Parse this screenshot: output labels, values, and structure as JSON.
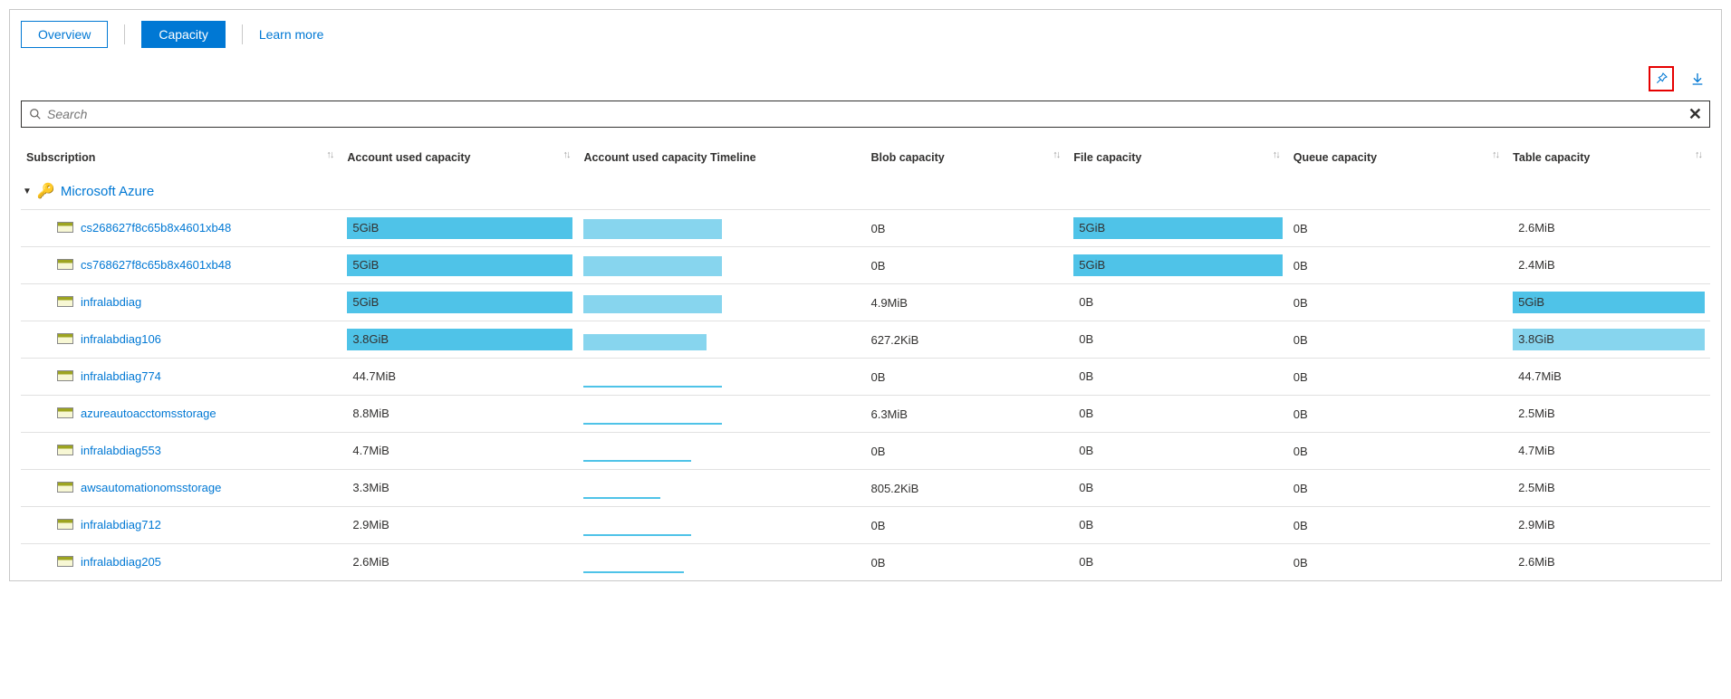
{
  "tabs": {
    "overview": "Overview",
    "capacity": "Capacity"
  },
  "learn_more": "Learn more",
  "search": {
    "placeholder": "Search"
  },
  "columns": {
    "c0": "Subscription",
    "c1": "Account used capacity",
    "c2": "Account used capacity Timeline",
    "c3": "Blob capacity",
    "c4": "File capacity",
    "c5": "Queue capacity",
    "c6": "Table capacity"
  },
  "group": "Microsoft Azure",
  "rows": [
    {
      "name": "cs268627f8c65b8x4601xb48",
      "used": "5GiB",
      "used_pct": 100,
      "tl_h": 22,
      "tl_w": 90,
      "blob": "0B",
      "file": "5GiB",
      "file_pct": 100,
      "queue": "0B",
      "table": "2.6MiB",
      "table_pct": 0
    },
    {
      "name": "cs768627f8c65b8x4601xb48",
      "used": "5GiB",
      "used_pct": 100,
      "tl_h": 22,
      "tl_w": 90,
      "blob": "0B",
      "file": "5GiB",
      "file_pct": 100,
      "queue": "0B",
      "table": "2.4MiB",
      "table_pct": 0
    },
    {
      "name": "infralabdiag",
      "used": "5GiB",
      "used_pct": 100,
      "tl_h": 20,
      "tl_w": 90,
      "blob": "4.9MiB",
      "file": "0B",
      "file_pct": 0,
      "queue": "0B",
      "table": "5GiB",
      "table_pct": 100
    },
    {
      "name": "infralabdiag106",
      "used": "3.8GiB",
      "used_pct": 100,
      "tl_h": 18,
      "tl_w": 80,
      "blob": "627.2KiB",
      "file": "0B",
      "file_pct": 0,
      "queue": "0B",
      "table": "3.8GiB",
      "table_pct": 100,
      "light": true
    },
    {
      "name": "infralabdiag774",
      "used": "44.7MiB",
      "used_pct": 0,
      "tl_h": 2,
      "tl_w": 90,
      "blob": "0B",
      "file": "0B",
      "file_pct": 0,
      "queue": "0B",
      "table": "44.7MiB",
      "table_pct": 0
    },
    {
      "name": "azureautoacctomsstorage",
      "used": "8.8MiB",
      "used_pct": 0,
      "tl_h": 2,
      "tl_w": 90,
      "blob": "6.3MiB",
      "file": "0B",
      "file_pct": 0,
      "queue": "0B",
      "table": "2.5MiB",
      "table_pct": 0
    },
    {
      "name": "infralabdiag553",
      "used": "4.7MiB",
      "used_pct": 0,
      "tl_h": 2,
      "tl_w": 70,
      "blob": "0B",
      "file": "0B",
      "file_pct": 0,
      "queue": "0B",
      "table": "4.7MiB",
      "table_pct": 0
    },
    {
      "name": "awsautomationomsstorage",
      "used": "3.3MiB",
      "used_pct": 0,
      "tl_h": 2,
      "tl_w": 50,
      "blob": "805.2KiB",
      "file": "0B",
      "file_pct": 0,
      "queue": "0B",
      "table": "2.5MiB",
      "table_pct": 0
    },
    {
      "name": "infralabdiag712",
      "used": "2.9MiB",
      "used_pct": 0,
      "tl_h": 2,
      "tl_w": 70,
      "blob": "0B",
      "file": "0B",
      "file_pct": 0,
      "queue": "0B",
      "table": "2.9MiB",
      "table_pct": 0
    },
    {
      "name": "infralabdiag205",
      "used": "2.6MiB",
      "used_pct": 0,
      "tl_h": 2,
      "tl_w": 65,
      "blob": "0B",
      "file": "0B",
      "file_pct": 0,
      "queue": "0B",
      "table": "2.6MiB",
      "table_pct": 0
    }
  ]
}
